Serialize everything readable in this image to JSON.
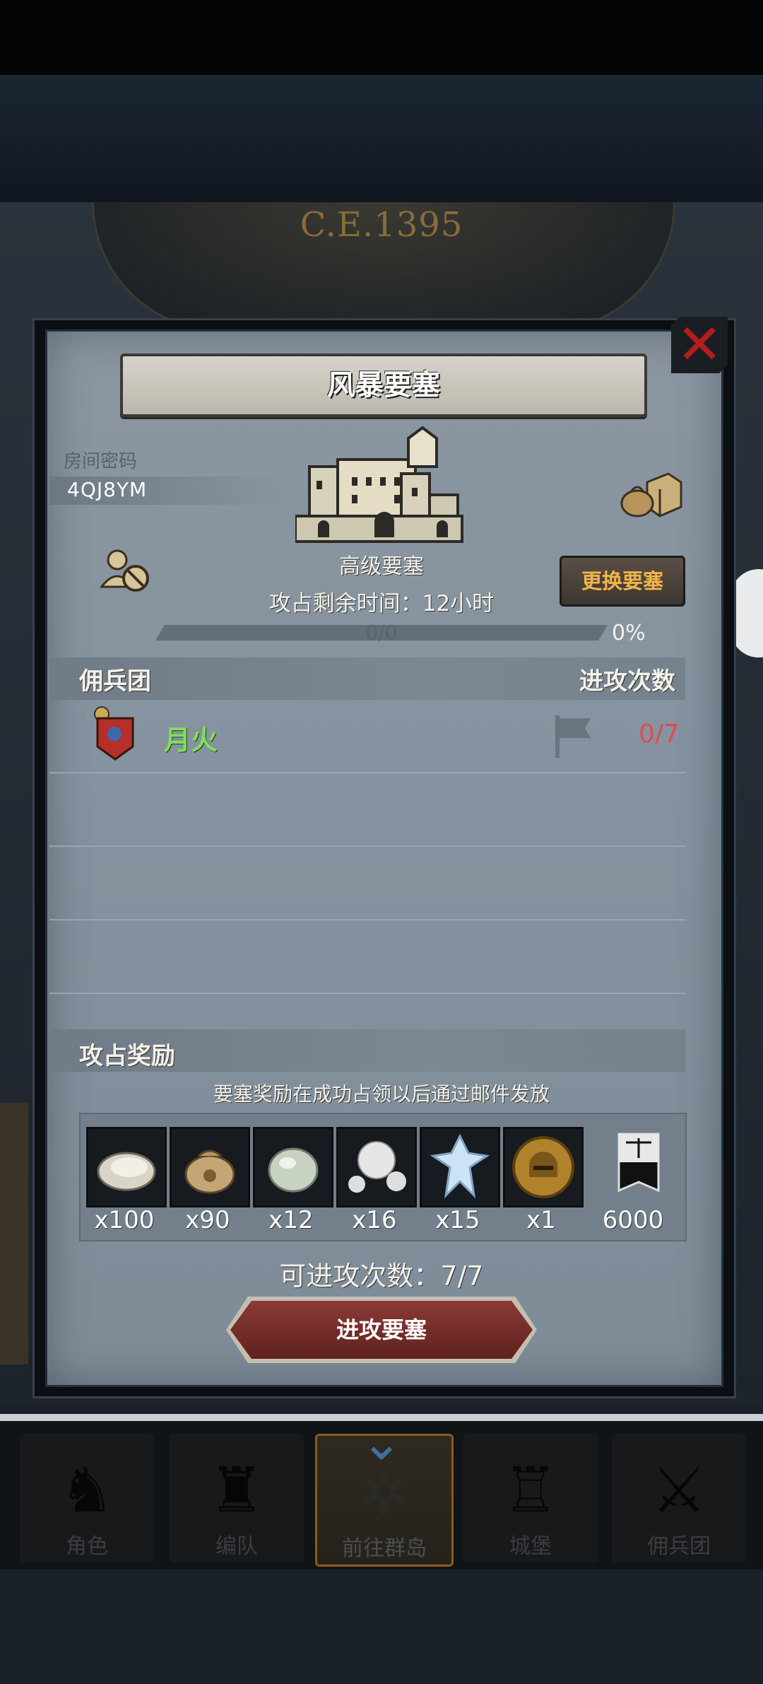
{
  "header": {
    "era": "C.E.1395"
  },
  "dialog": {
    "title": "风暴要塞",
    "room_code_label": "房间密码",
    "room_code": "4QJ8YM",
    "fortress_level": "高级要塞",
    "occupy_time_label": "攻占剩余时间：12小时",
    "change_button": "更换要塞",
    "progress": {
      "text": "0/0",
      "percent_label": "0%",
      "fraction": 0
    },
    "mercenary_header": "佣兵团",
    "attack_count_header": "进攻次数",
    "guilds": [
      {
        "name": "月火",
        "attacks": "0/7"
      }
    ],
    "reward_header": "攻占奖励",
    "reward_note": "要塞奖励在成功占领以后通过邮件发放",
    "rewards": [
      {
        "icon": "oyster-icon",
        "qty": "x100"
      },
      {
        "icon": "coin-bag-icon",
        "qty": "x90"
      },
      {
        "icon": "stone-icon",
        "qty": "x12"
      },
      {
        "icon": "pearl-icon",
        "qty": "x16"
      },
      {
        "icon": "crystal-icon",
        "qty": "x15"
      },
      {
        "icon": "helmet-coin-icon",
        "qty": "x1"
      },
      {
        "icon": "justice-banner-icon",
        "qty": "6000"
      }
    ],
    "attacks_available": "可进攻次数：7/7",
    "attack_button": "进攻要塞",
    "colors": {
      "guild_name": "#7fe05a",
      "attack_count": "#e34b4b",
      "change_button_text": "#f1b548"
    }
  },
  "bottom_nav": {
    "items": [
      {
        "label": "角色",
        "icon": "knight-icon"
      },
      {
        "label": "编队",
        "icon": "formation-icon"
      },
      {
        "label": "前往群岛",
        "icon": "compass-map-icon"
      },
      {
        "label": "城堡",
        "icon": "castle-icon"
      },
      {
        "label": "佣兵团",
        "icon": "mercenary-icon"
      }
    ],
    "active_index": 2
  }
}
